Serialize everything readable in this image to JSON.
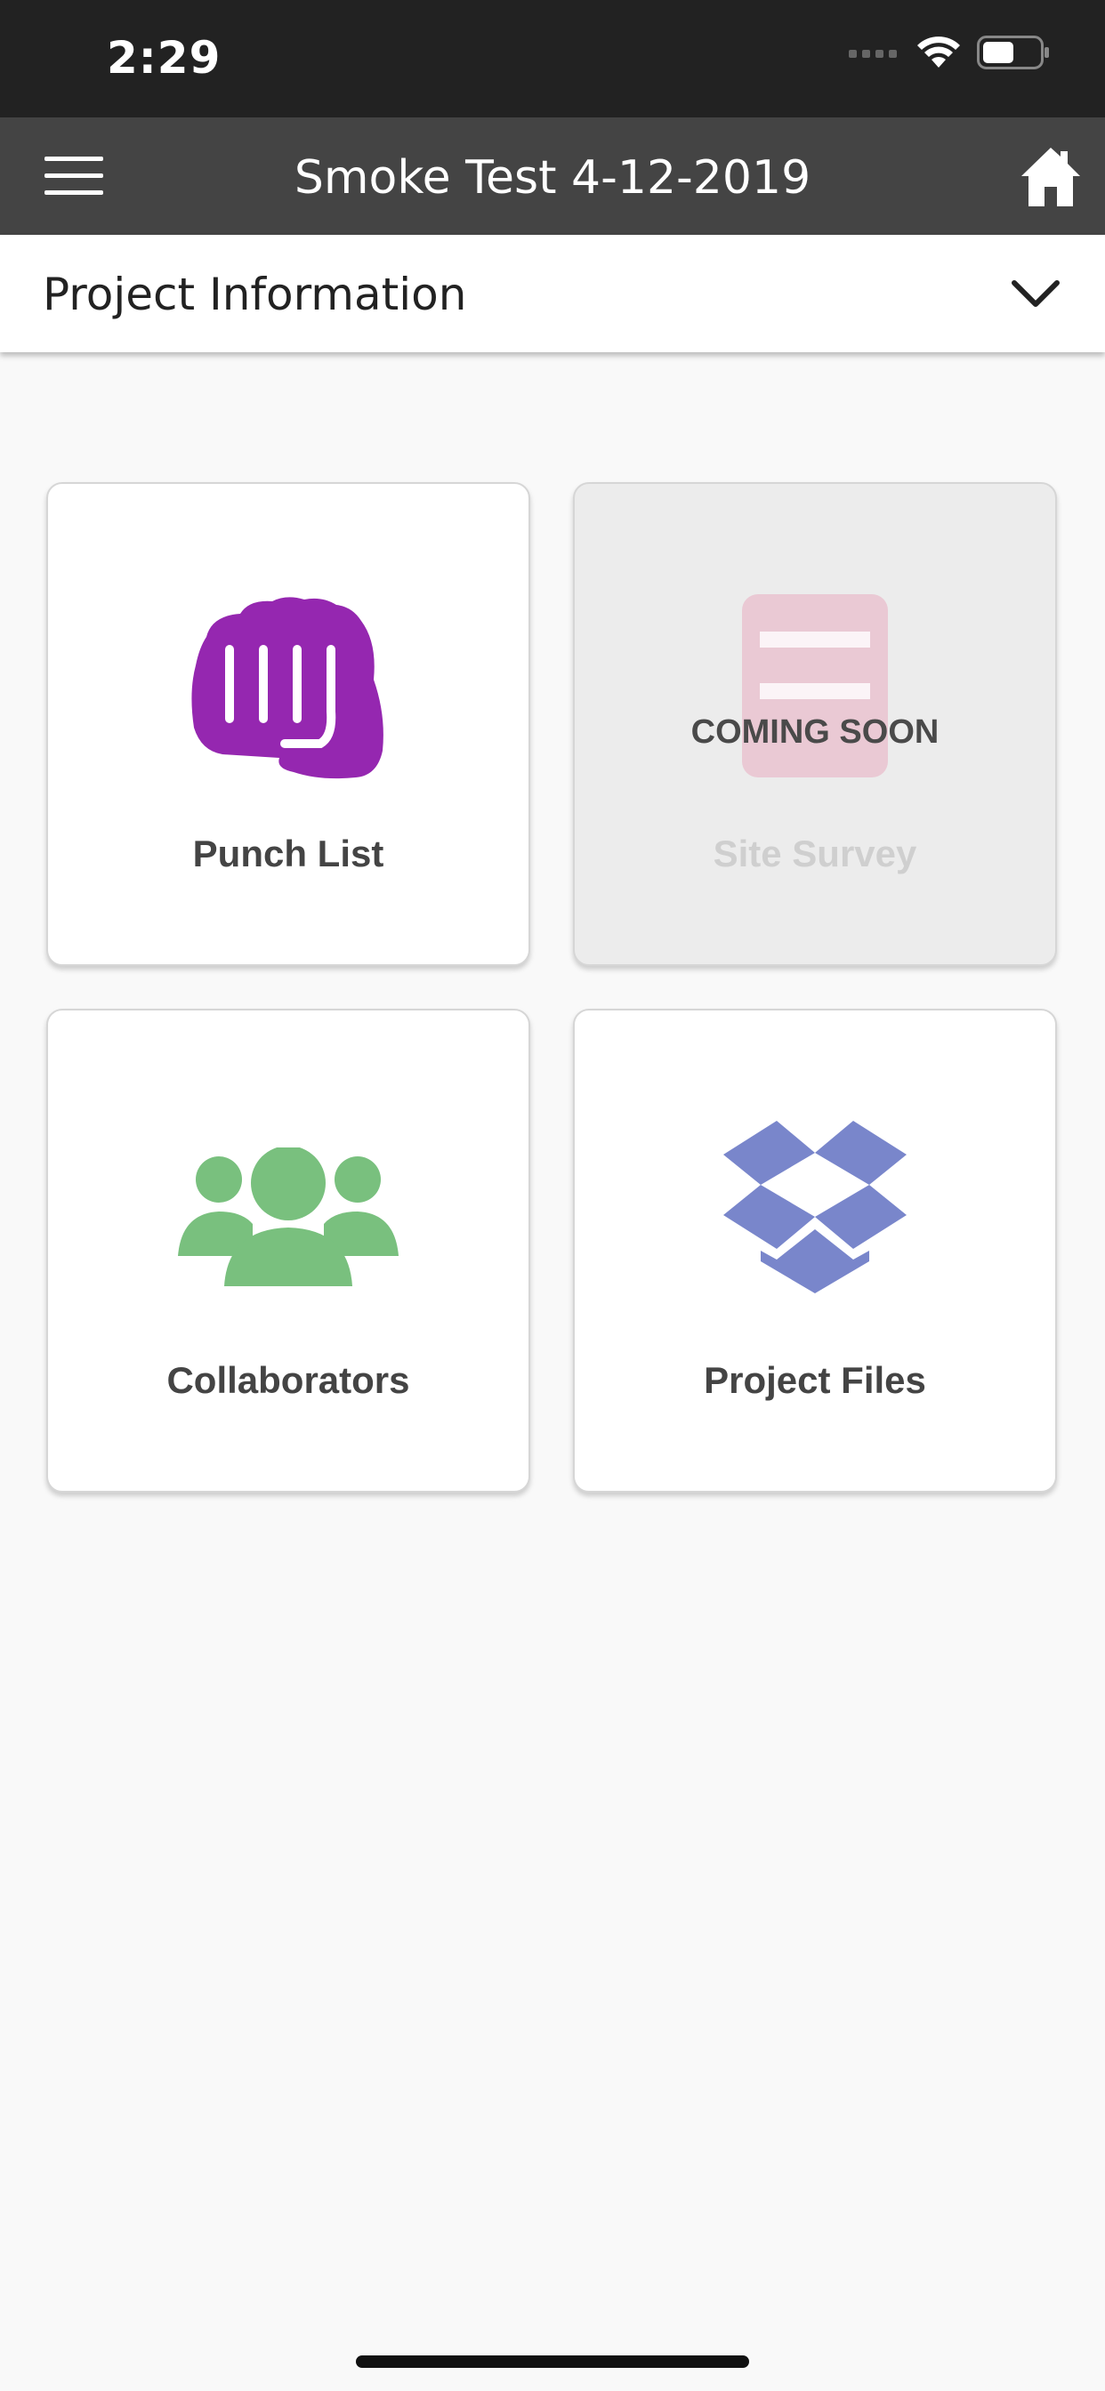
{
  "status_bar": {
    "time": "2:29"
  },
  "nav": {
    "title": "Smoke Test 4-12-2019",
    "menu_icon": "hamburger-menu-icon",
    "home_icon": "home-icon"
  },
  "project_info": {
    "label": "Project Information",
    "chevron_icon": "chevron-down-icon"
  },
  "tiles": [
    {
      "label": "Punch List",
      "icon": "fist-icon",
      "color": "#9527B0",
      "enabled": true
    },
    {
      "label": "Site Survey",
      "icon": "survey-form-icon",
      "color": "#E9A0B8",
      "enabled": false,
      "overlay": "COMING SOON"
    },
    {
      "label": "Collaborators",
      "icon": "people-group-icon",
      "color": "#79C07E",
      "enabled": true
    },
    {
      "label": "Project Files",
      "icon": "dropbox-icon",
      "color": "#7986CB",
      "enabled": true
    }
  ],
  "colors": {
    "status_bar_bg": "#222222",
    "nav_bg": "#444444",
    "page_bg": "#F9F9F9"
  }
}
